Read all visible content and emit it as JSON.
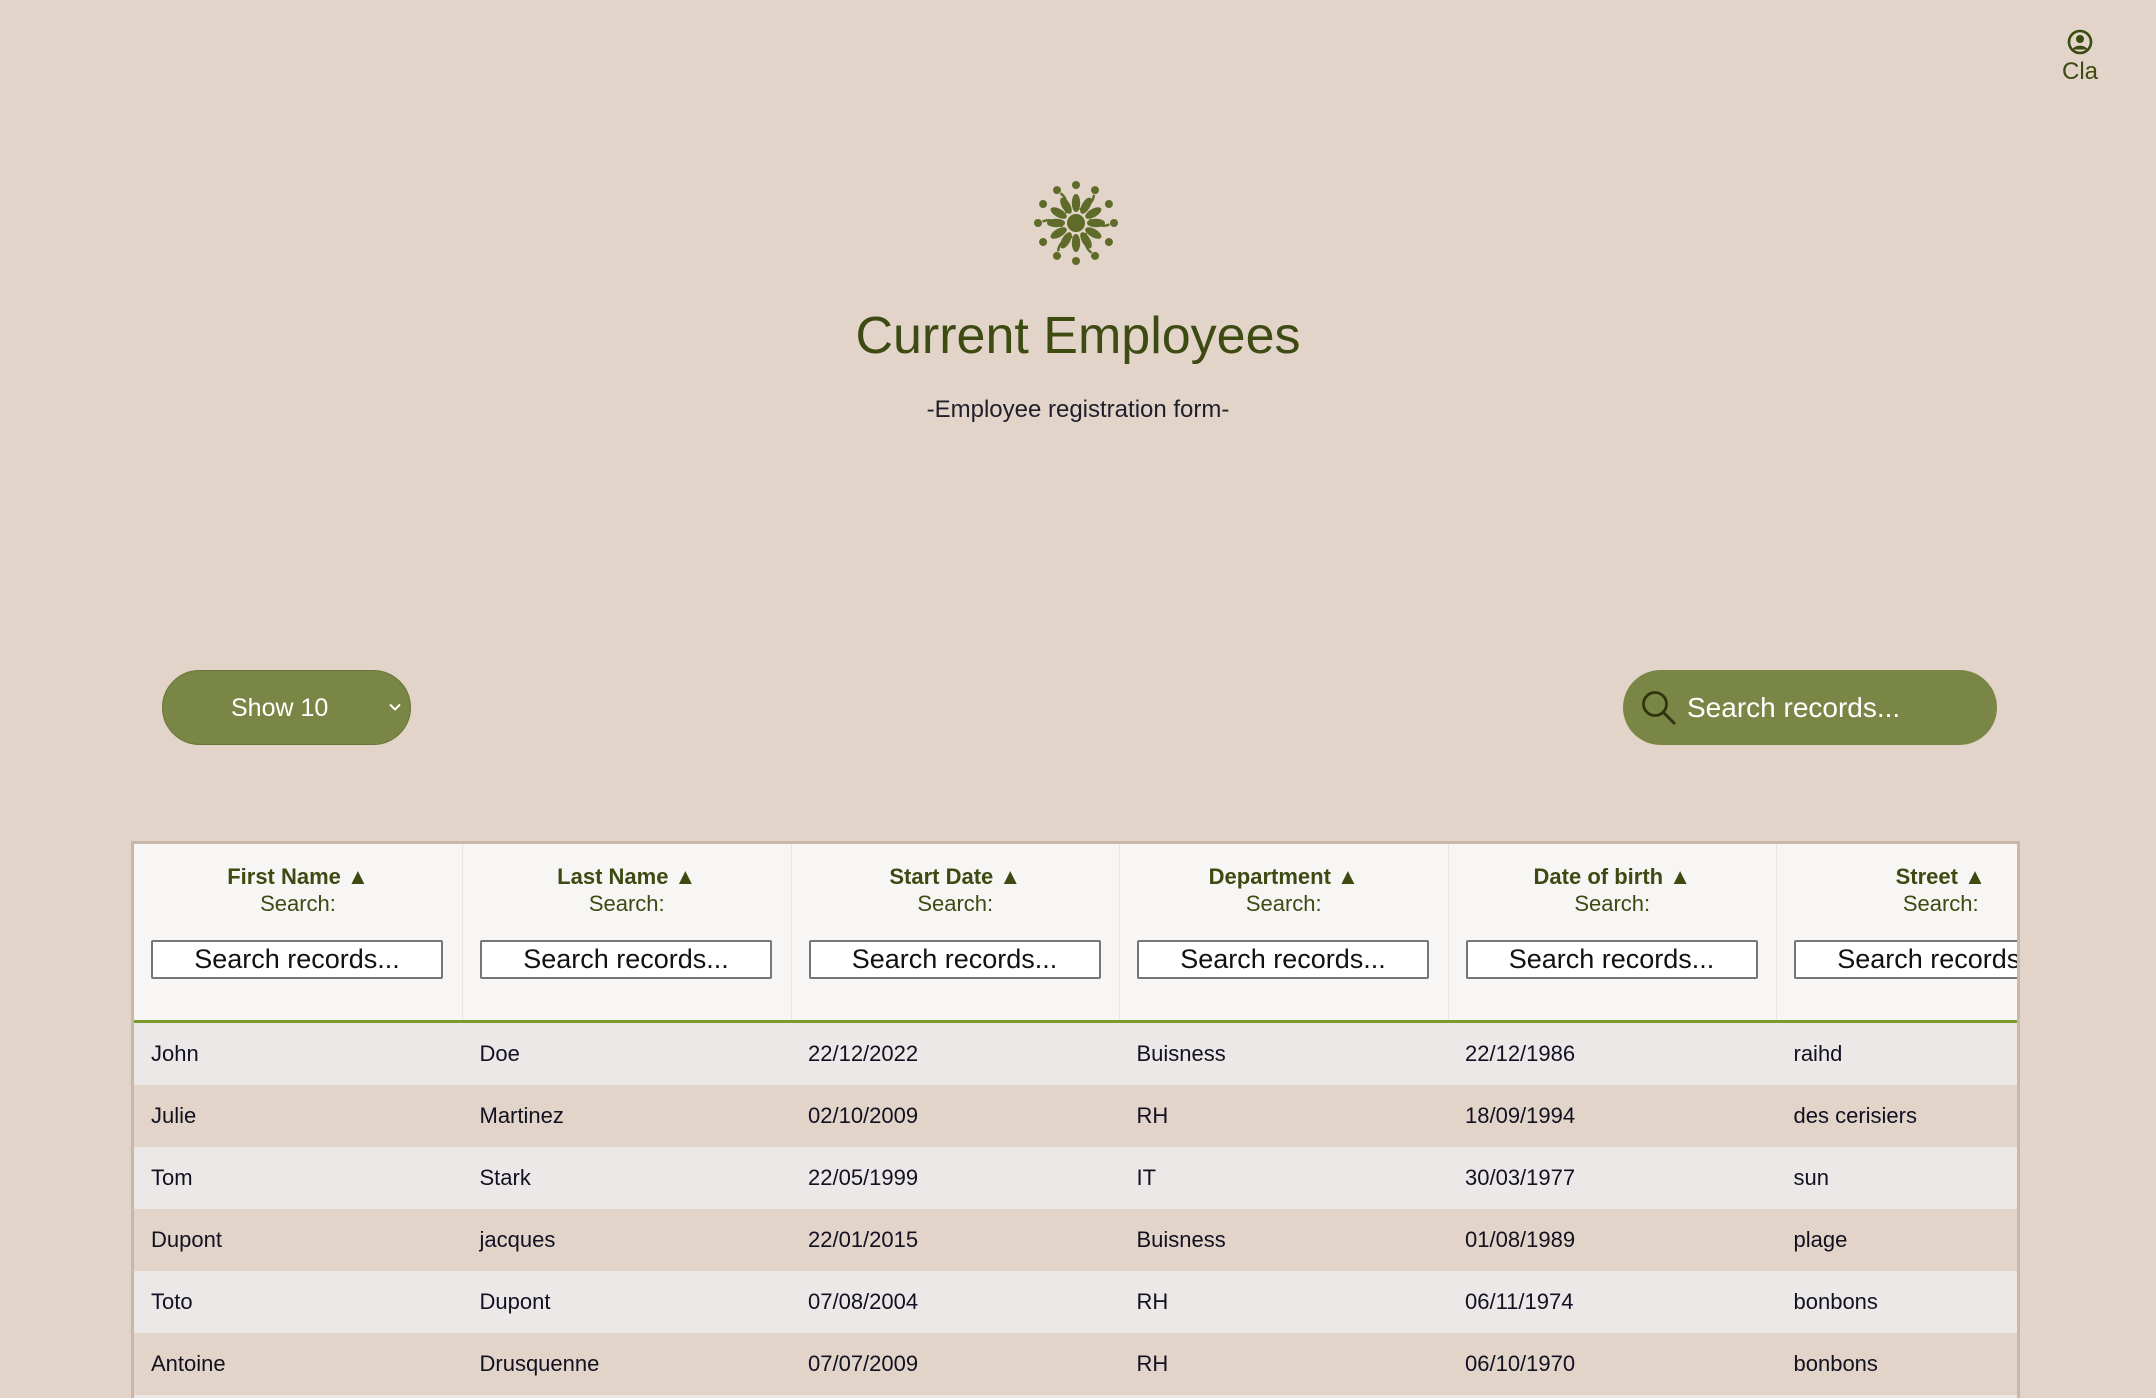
{
  "user": {
    "icon": "user-circle-icon",
    "name": "Cla"
  },
  "header": {
    "logo_icon": "flower-mandala-icon",
    "title": "Current Employees",
    "subtitle": "-Employee registration form-"
  },
  "controls": {
    "show_label": "Show 10",
    "search_placeholder": "Search records...",
    "search_icon": "search-icon"
  },
  "table": {
    "search_label": "Search:",
    "column_search_placeholder": "Search records...",
    "columns": [
      {
        "label": "First Name ▲"
      },
      {
        "label": "Last Name ▲"
      },
      {
        "label": "Start Date ▲"
      },
      {
        "label": "Department ▲"
      },
      {
        "label": "Date of birth ▲"
      },
      {
        "label": "Street ▲"
      }
    ],
    "rows": [
      [
        "John",
        "Doe",
        "22/12/2022",
        "Buisness",
        "22/12/1986",
        "raihd"
      ],
      [
        "Julie",
        "Martinez",
        "02/10/2009",
        "RH",
        "18/09/1994",
        "des cerisiers"
      ],
      [
        "Tom",
        "Stark",
        "22/05/1999",
        "IT",
        "30/03/1977",
        "sun"
      ],
      [
        "Dupont",
        "jacques",
        "22/01/2015",
        "Buisness",
        "01/08/1989",
        "plage"
      ],
      [
        "Toto",
        "Dupont",
        "07/08/2004",
        "RH",
        "06/11/1974",
        "bonbons"
      ],
      [
        "Antoine",
        "Drusquenne",
        "07/07/2009",
        "RH",
        "06/10/1970",
        "bonbons"
      ],
      [
        "",
        "",
        "",
        "",
        "",
        ""
      ]
    ]
  },
  "colors": {
    "background": "#e2d4c9",
    "accent": "#7a8645",
    "title": "#3d4a12",
    "header_rule": "#7d9a2c"
  }
}
